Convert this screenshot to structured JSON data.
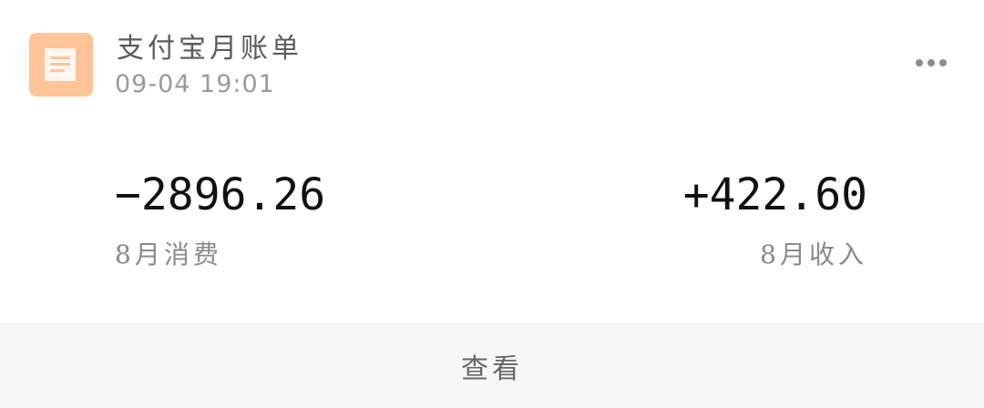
{
  "header": {
    "app_icon": "document-icon",
    "title": "支付宝月账单",
    "timestamp": "09-04 19:01",
    "more_icon": "more-dots-icon"
  },
  "summary": {
    "expense_amount": "−2896.26",
    "expense_label": "8月消费",
    "income_amount": "+422.60",
    "income_label": "8月收入"
  },
  "footer": {
    "view_label": "查看"
  },
  "colors": {
    "icon_bg": "#ffc497",
    "footer_bg": "#f7f7f7"
  }
}
